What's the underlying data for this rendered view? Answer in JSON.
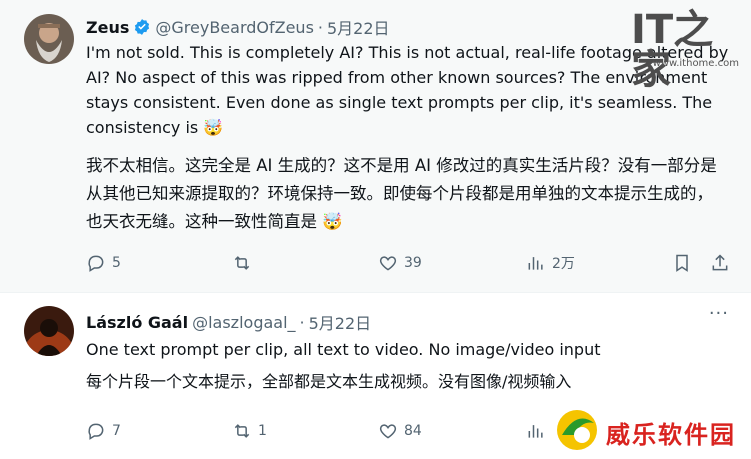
{
  "tweets": [
    {
      "name": "Zeus",
      "handle": "@GreyBeardOfZeus",
      "separator": "·",
      "date": "5月22日",
      "text_en": "I'm not sold. This is completely AI? This is not actual, real-life footage altered by AI? No aspect of this was ripped from other known sources? The environment stays consistent. Even done as single text prompts per clip, it's seamless. The consistency is 🤯",
      "text_zh": "我不太相信。这完全是 AI 生成的？这不是用 AI 修改过的真实生活片段？没有一部分是从其他已知来源提取的？环境保持一致。即使每个片段都是用单独的文本提示生成的，也天衣无缝。这种一致性简直是 🤯",
      "replies": "5",
      "reposts": "",
      "likes": "39",
      "views": "2万"
    },
    {
      "name": "László Gaál",
      "handle": "@laszlogaal_",
      "separator": "·",
      "date": "5月22日",
      "text_en": "One text prompt per clip, all text to video. No image/video input",
      "text_zh": "每个片段一个文本提示，全部都是文本生成视频。没有图像/视频输入",
      "replies": "7",
      "reposts": "1",
      "likes": "84",
      "more": "···"
    }
  ],
  "watermarks": {
    "logo": "IT之家",
    "url": "www.ithome.com",
    "brand": "威乐软件园"
  },
  "colors": {
    "verified": "#1d9bf0",
    "muted": "#536471",
    "text": "#0f1419",
    "brand_red": "#d9231f"
  }
}
